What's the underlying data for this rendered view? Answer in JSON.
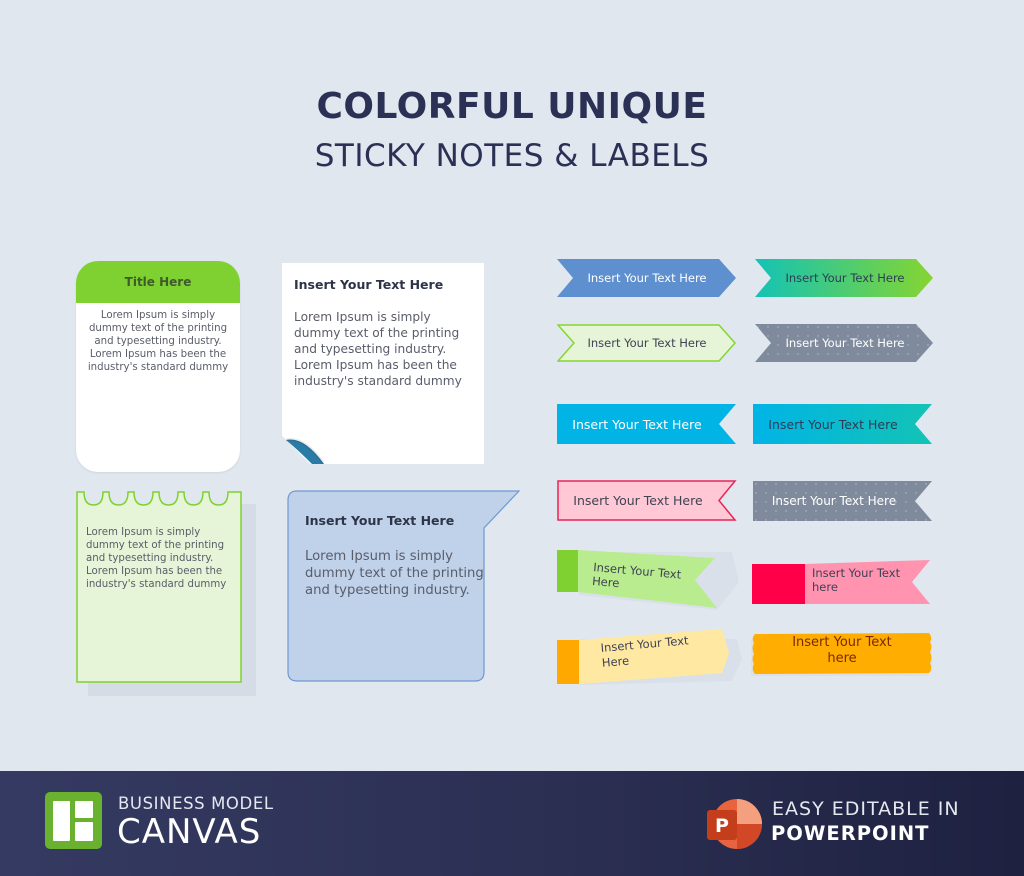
{
  "header": {
    "title_line1": "COLORFUL UNIQUE",
    "title_line2": "STICKY NOTES & LABELS"
  },
  "notes": [
    {
      "id": "rounded-title-card",
      "title": "Title Here",
      "body": "Lorem Ipsum is simply dummy text of the printing and typesetting industry. Lorem Ipsum has been the industry's standard dummy",
      "header_color": "#7ed131"
    },
    {
      "id": "curled-paper",
      "title": "Insert Your Text Here",
      "body": "Lorem Ipsum is simply dummy text of the printing and typesetting industry. Lorem Ipsum has been the industry's standard dummy",
      "curl_color": "#2a7ba6"
    },
    {
      "id": "scalloped-green",
      "body": "Lorem Ipsum is simply dummy text of the printing and typesetting industry. Lorem Ipsum has been the industry's standard dummy",
      "fill_color": "#e6f5d8",
      "border_color": "#7ed131"
    },
    {
      "id": "blue-callout",
      "title": "Insert Your Text Here",
      "body": "Lorem Ipsum is simply dummy text of the printing and typesetting industry.",
      "fill_color": "#bfd2ea",
      "border_color": "#6f98d3"
    }
  ],
  "labels": [
    {
      "text": "Insert Your Text Here",
      "style": "arrow-blue",
      "fill": "#5e8fce",
      "text_color": "#ffffff"
    },
    {
      "text": "Insert Your Text Here",
      "style": "arrow-gradient",
      "fill_from": "#13c3b5",
      "fill_to": "#86d530",
      "text_color": "#2d3c55"
    },
    {
      "text": "Insert Your Text Here",
      "style": "arrow-green-outline",
      "fill": "#e6f5d8",
      "border": "#86d530",
      "text_color": "#3e4254"
    },
    {
      "text": "Insert Your Text Here",
      "style": "arrow-gray-dotted",
      "fill": "#7f8a9c",
      "text_color": "#ffffff"
    },
    {
      "text": "Insert Your Text Here",
      "style": "ribbon-cyan",
      "fill": "#00b4e6",
      "text_color": "#ffffff"
    },
    {
      "text": "Insert Your Text Here",
      "style": "ribbon-gradient",
      "fill_from": "#00b4e6",
      "fill_to": "#13c3b5",
      "text_color": "#2d3c55"
    },
    {
      "text": "Insert Your Text Here",
      "style": "ribbon-pink-outline",
      "fill": "#ffc8d4",
      "border": "#e8245a",
      "text_color": "#3e4254"
    },
    {
      "text": "Insert Your Text Here",
      "style": "ribbon-gray-dotted",
      "fill": "#7f8a9c",
      "text_color": "#ffffff"
    },
    {
      "text_line1": "Insert Your Text",
      "text_line2": "Here",
      "style": "tab-green",
      "tab": "#7ed131",
      "fill": "#b9ec8e",
      "text_color": "#3e4254"
    },
    {
      "text_line1": "Insert Your Text",
      "text_line2": "here",
      "style": "tab-pink",
      "tab": "#ff0048",
      "fill": "#ff93b0",
      "text_color": "#3e4254"
    },
    {
      "text_line1": "Insert Your Text",
      "text_line2": "Here",
      "style": "tab-yellow",
      "tab": "#ffa800",
      "fill": "#ffe8a1",
      "text_color": "#3e4254"
    },
    {
      "text_line1": "Insert Your Text",
      "text_line2": "here",
      "style": "wavy-orange",
      "fill": "#ffad00",
      "text_color": "#7a2a00"
    }
  ],
  "footer": {
    "brand_line1": "BUSINESS MODEL",
    "brand_line2": "CANVAS",
    "brand_logo_icon": "canvas-grid-icon",
    "brand_color": "#6ab130",
    "ppt_line1": "EASY EDITABLE IN",
    "ppt_line2": "POWERPOINT",
    "ppt_icon": "powerpoint-icon",
    "ppt_letter": "P",
    "ppt_color": "#d24726"
  }
}
